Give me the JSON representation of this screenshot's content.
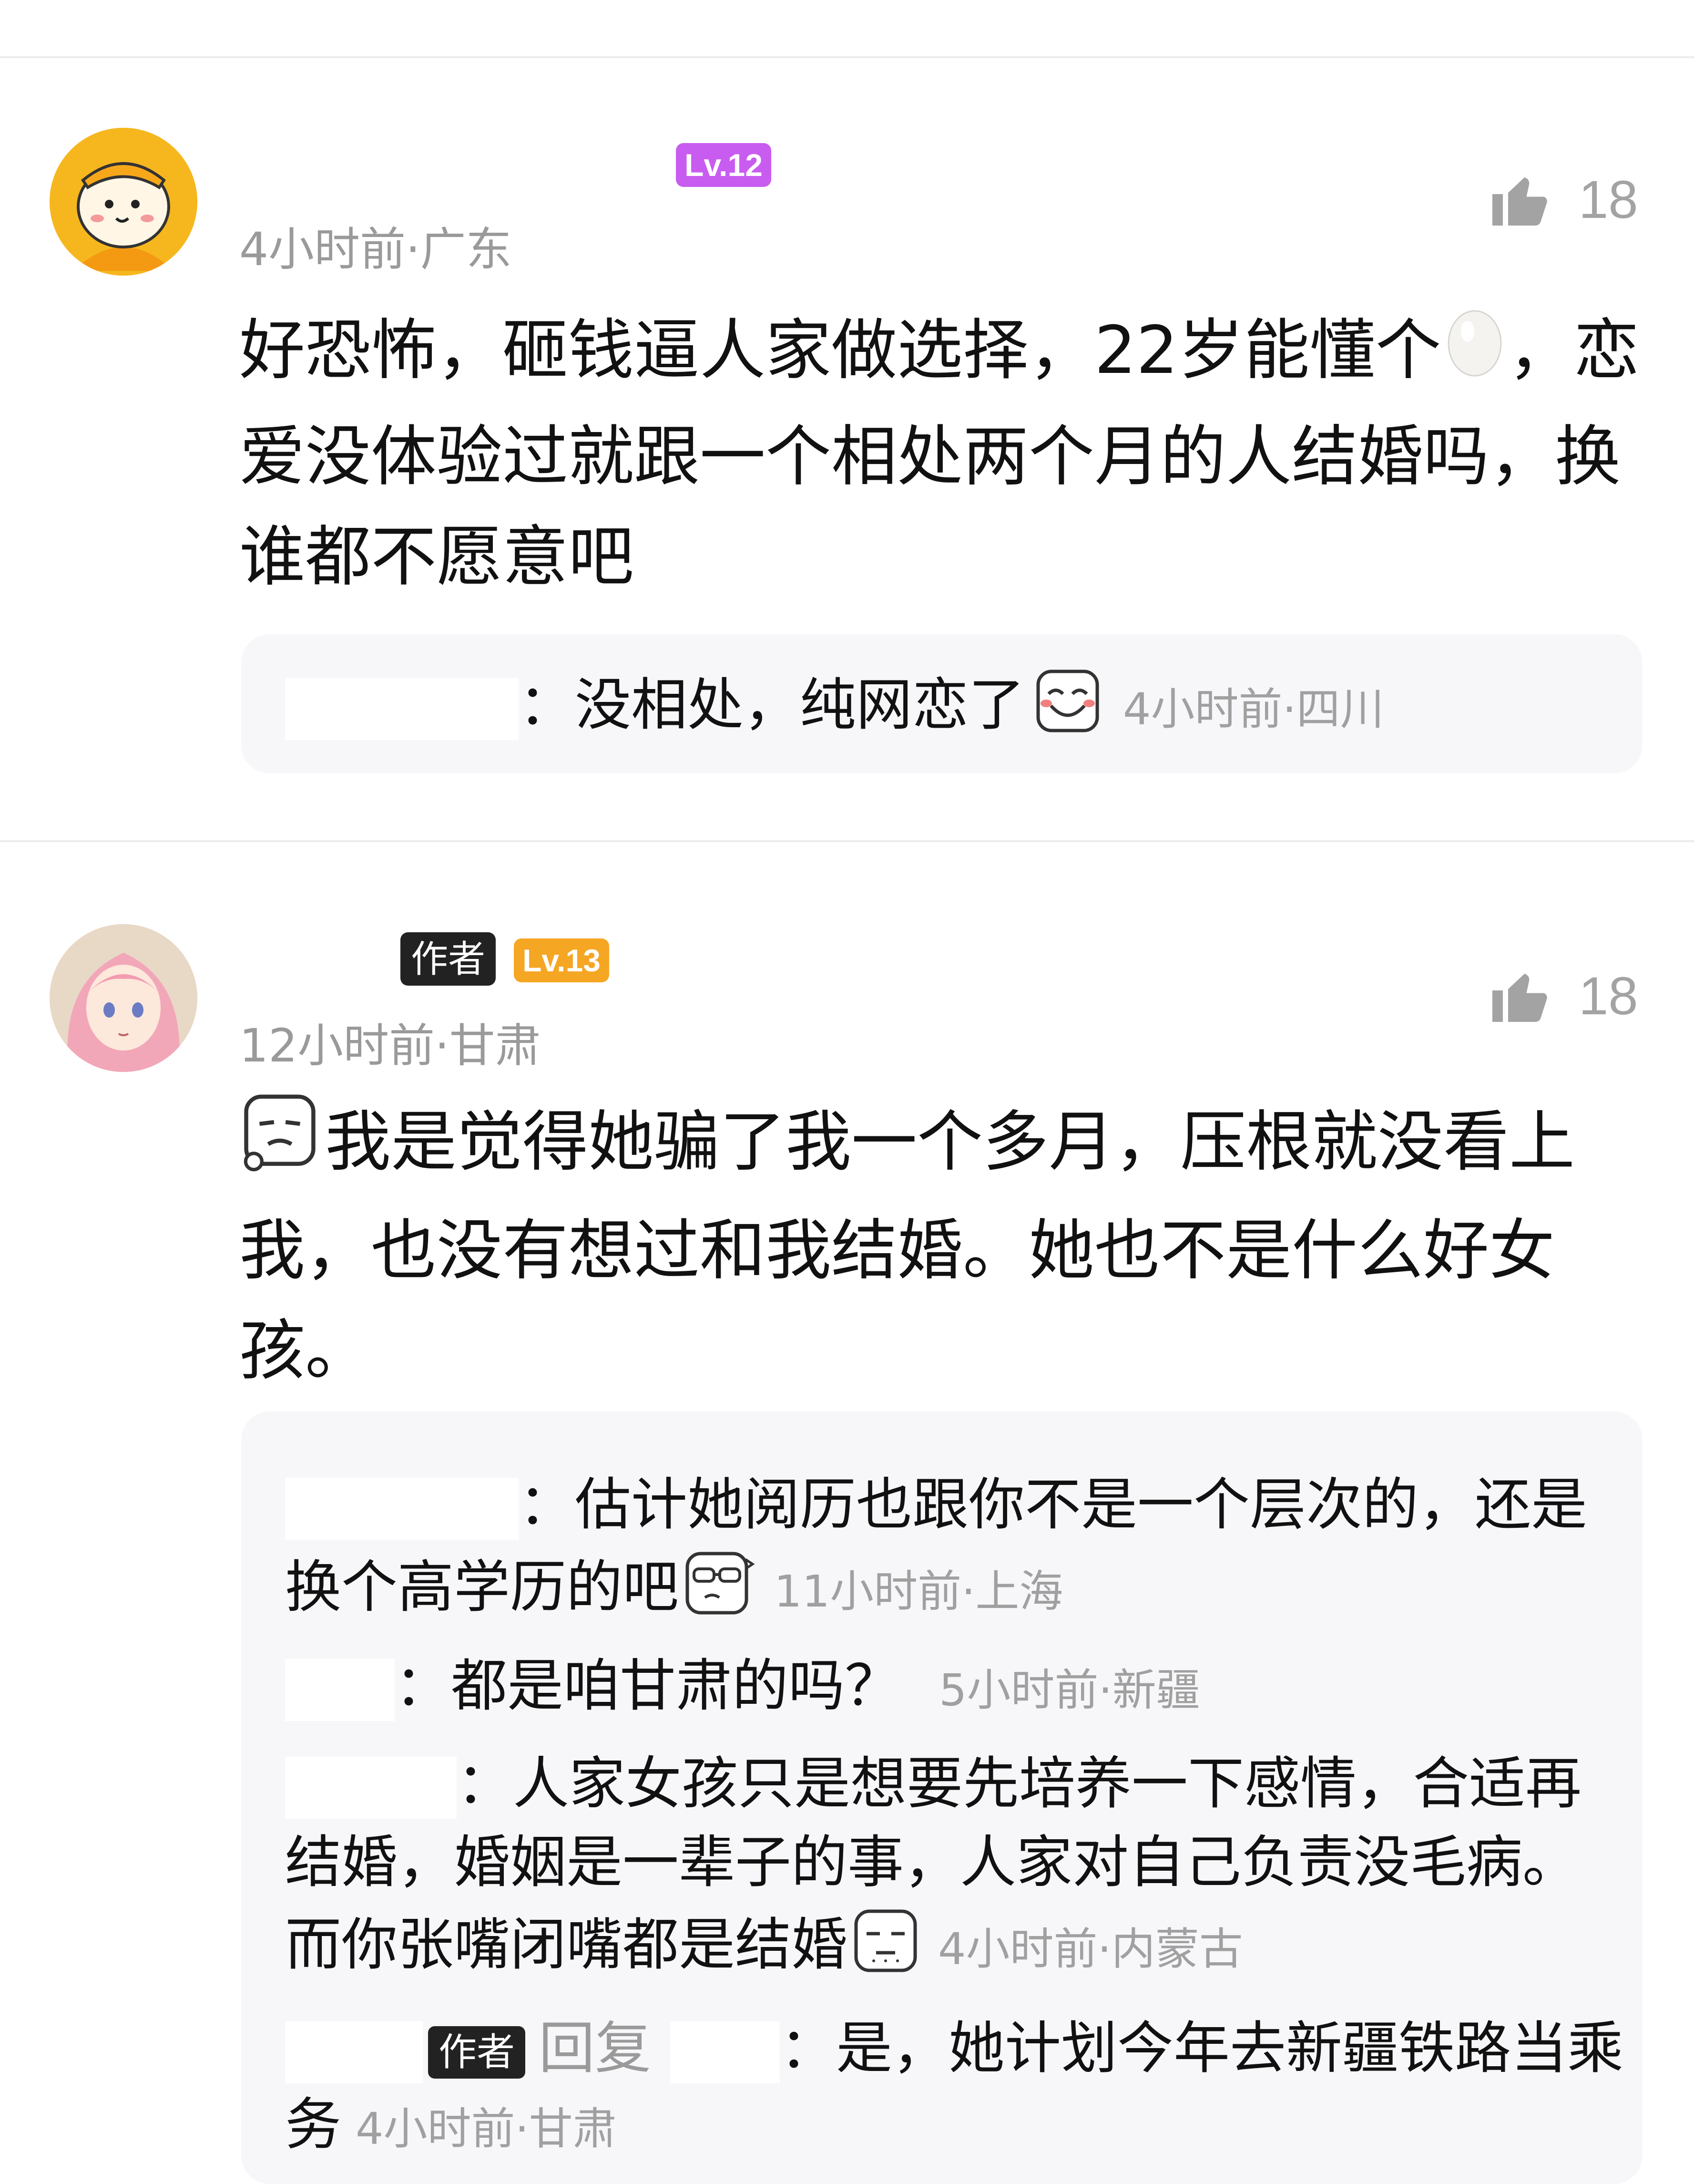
{
  "comments": [
    {
      "level": "Lv.12",
      "level_color": "#c95cf0",
      "meta": "4小时前·广东",
      "likes": "18",
      "text_lines": [
        "好恐怖，砸钱逼人家做选择，22岁能懂个",
        "爱没体验过就跟一个相处两个月的人结婚吗，换",
        "谁都不愿意吧"
      ],
      "text_tail_after_emoji": "，恋",
      "emoji": "egg-emoji",
      "replies": [
        {
          "text": "：没相处，纯网恋了",
          "emoji": "grin-emoji",
          "meta": "4小时前·四川"
        }
      ]
    },
    {
      "author_tag": "作者",
      "level": "Lv.13",
      "level_color": "#f5a623",
      "meta": "12小时前·甘肃",
      "likes": "18",
      "leading_emoji": "sigh-emoji",
      "text_lines": [
        "我是觉得她骗了我一个多月，压根就没看上",
        "我，也没有想过和我结婚。她也不是什么好女",
        "孩。"
      ],
      "replies": [
        {
          "line1": "：估计她阅历也跟你不是一个层次的，还是",
          "line2": "换个高学历的吧",
          "emoji": "smug-emoji",
          "meta": "11小时前·上海"
        },
        {
          "text": "：都是咱甘肃的吗？",
          "meta": "5小时前·新疆"
        },
        {
          "line1": "：人家女孩只是想要先培养一下感情，合适再",
          "line2": "结婚，婚姻是一辈子的事，人家对自己负责没毛病。",
          "line3": "而你张嘴闭嘴都是结婚",
          "emoji": "deadpan-emoji",
          "meta": "4小时前·内蒙古"
        },
        {
          "author_tag": "作者",
          "reply_word": "回复",
          "line1": "：是，她计划今年去新疆铁路当乘",
          "line2": "务",
          "meta": "4小时前·甘肃"
        }
      ]
    }
  ]
}
